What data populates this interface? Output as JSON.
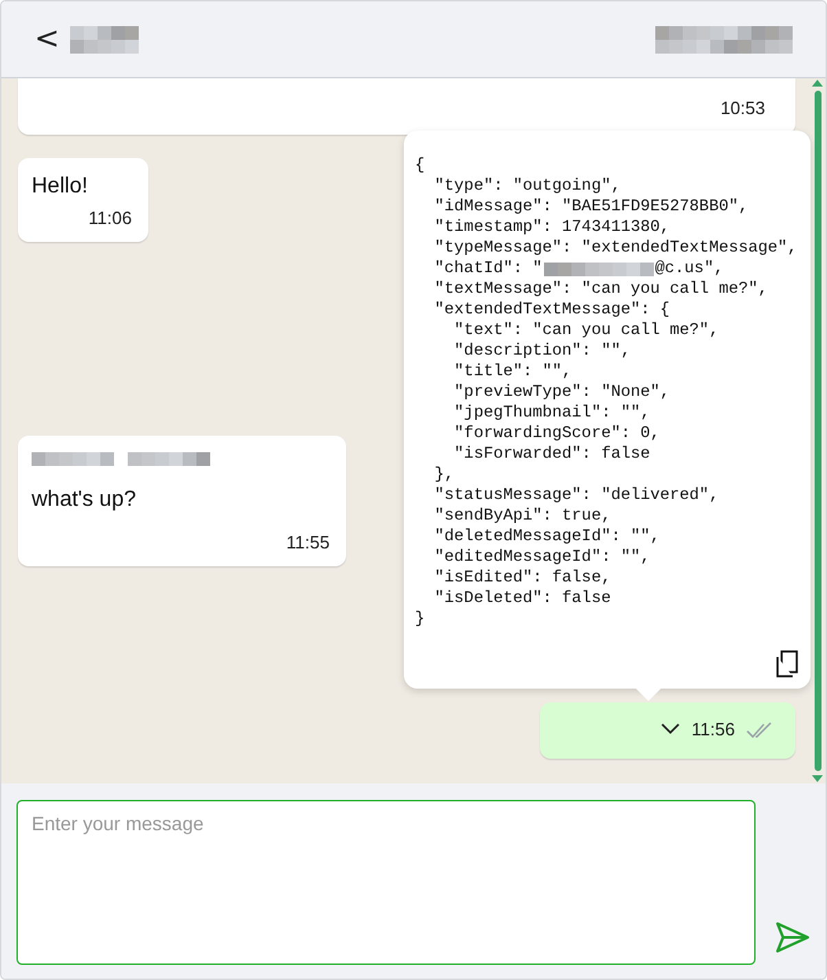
{
  "header": {
    "back_icon": "<"
  },
  "messages": [
    {
      "kind": "incoming",
      "time": "10:53",
      "sender_redacted": false
    },
    {
      "kind": "incoming",
      "text": "Hello!",
      "time": "11:06",
      "sender_redacted": false
    },
    {
      "kind": "incoming",
      "text": "what's up?",
      "time": "11:55",
      "sender_redacted": true
    },
    {
      "kind": "outgoing",
      "time": "11:56",
      "ticks_read": false
    }
  ],
  "json_popup": {
    "lines": [
      {
        "text": "{"
      },
      {
        "text": "  \"type\": \"outgoing\","
      },
      {
        "text": "  \"idMessage\": \"BAE51FD9E5278BB0\","
      },
      {
        "text": "  \"timestamp\": 1743411380,"
      },
      {
        "text": "  \"typeMessage\": \"extendedTextMessage\","
      },
      {
        "text": "  \"chatId\": \"",
        "redacted_after": "@c.us\","
      },
      {
        "text": "  \"textMessage\": \"can you call me?\","
      },
      {
        "text": "  \"extendedTextMessage\": {"
      },
      {
        "text": "    \"text\": \"can you call me?\","
      },
      {
        "text": "    \"description\": \"\","
      },
      {
        "text": "    \"title\": \"\","
      },
      {
        "text": "    \"previewType\": \"None\","
      },
      {
        "text": "    \"jpegThumbnail\": \"\","
      },
      {
        "text": "    \"forwardingScore\": 0,"
      },
      {
        "text": "    \"isForwarded\": false"
      },
      {
        "text": "  },"
      },
      {
        "text": "  \"statusMessage\": \"delivered\","
      },
      {
        "text": "  \"sendByApi\": true,"
      },
      {
        "text": "  \"deletedMessageId\": \"\","
      },
      {
        "text": "  \"editedMessageId\": \"\","
      },
      {
        "text": "  \"isEdited\": false,"
      },
      {
        "text": "  \"isDeleted\": false"
      },
      {
        "text": "}"
      }
    ]
  },
  "composer": {
    "placeholder": "Enter your message"
  }
}
